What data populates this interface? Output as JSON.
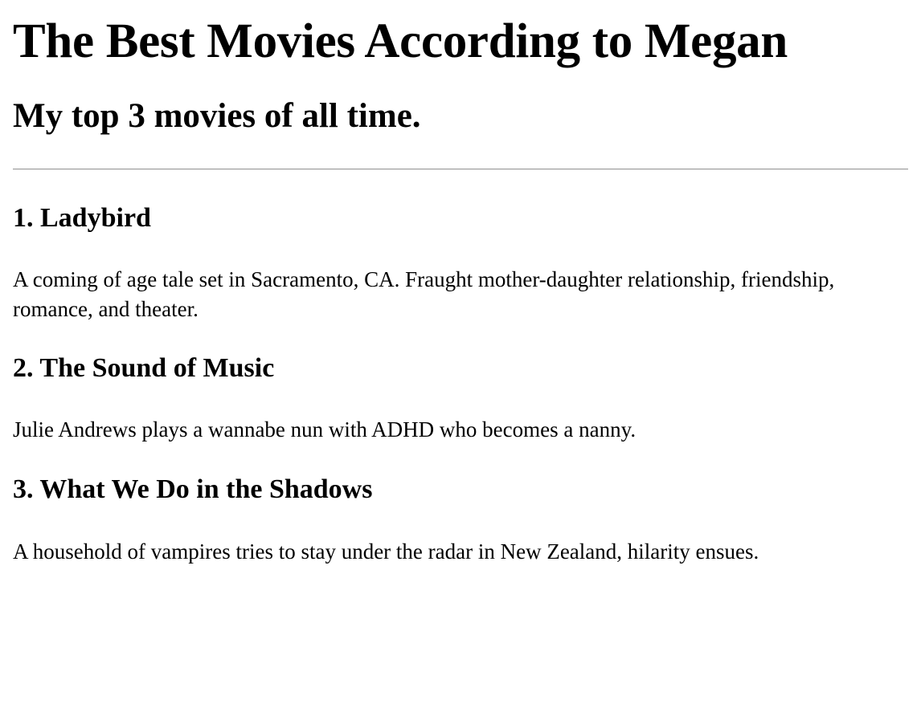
{
  "page": {
    "title": "The Best Movies According to Megan",
    "subtitle": "My top 3 movies of all time."
  },
  "movies": [
    {
      "heading": "1. Ladybird",
      "description": "A coming of age tale set in Sacramento, CA. Fraught mother-daughter relationship, friendship, romance, and theater."
    },
    {
      "heading": "2. The Sound of Music",
      "description": "Julie Andrews plays a wannabe nun with ADHD who becomes a nanny."
    },
    {
      "heading": "3. What We Do in the Shadows",
      "description": "A household of vampires tries to stay under the radar in New Zealand, hilarity ensues."
    }
  ]
}
